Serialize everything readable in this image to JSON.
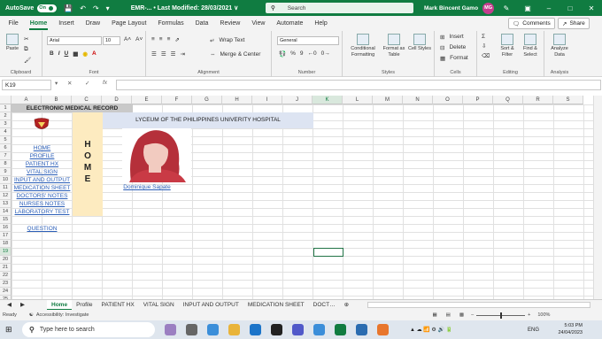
{
  "titlebar": {
    "autosave": "AutoSave",
    "toggle": "On",
    "title": "EMR-... • Last Modified: 28/03/2021 ∨",
    "search_placeholder": "Search",
    "user": "Mark Bincent Gamo",
    "initials": "MG"
  },
  "menu": {
    "tabs": [
      "File",
      "Home",
      "Insert",
      "Draw",
      "Page Layout",
      "Formulas",
      "Data",
      "Review",
      "View",
      "Automate",
      "Help"
    ],
    "comments": "Comments",
    "share": "Share"
  },
  "ribbon": {
    "clipboard": "Clipboard",
    "paste": "Paste",
    "font_name": "Arial",
    "font_size": "10",
    "font_label": "Font",
    "alignment": "Alignment",
    "wrap_text": "Wrap Text",
    "merge_center": "Merge & Center",
    "number_format": "General",
    "number": "Number",
    "conditional": "Conditional Formatting",
    "format_table": "Format as Table",
    "cell_styles": "Cell Styles",
    "styles": "Styles",
    "insert": "Insert",
    "delete": "Delete",
    "format": "Format",
    "cells": "Cells",
    "sort": "Sort & Filter",
    "find": "Find & Select",
    "editing": "Editing",
    "analyze": "Analyze Data",
    "analysis": "Analysis"
  },
  "formula": {
    "namebox": "K19",
    "fx": "fx"
  },
  "columns": [
    "A",
    "B",
    "C",
    "D",
    "E",
    "F",
    "G",
    "H",
    "I",
    "J",
    "K",
    "L",
    "M",
    "N",
    "O",
    "P",
    "Q",
    "R",
    "S"
  ],
  "rows": [
    "1",
    "2",
    "3",
    "4",
    "5",
    "6",
    "7",
    "8",
    "9",
    "10",
    "11",
    "12",
    "13",
    "14",
    "15",
    "16",
    "17",
    "18",
    "19",
    "20",
    "21",
    "22",
    "23",
    "24",
    "25"
  ],
  "sheet": {
    "header": "ELECTRONIC MEDICAL RECORD",
    "hospital": "LYCEUM OF THE PHILIPPINES UNIVERITY HOSPITAL",
    "home_letters": [
      "H",
      "O",
      "M",
      "E"
    ],
    "links": [
      "HOME",
      "PROFILE",
      "PATIENT HX",
      "VITAL SIGN",
      "INPUT AND OUTPUT",
      "MEDICATION SHEET",
      "DOCTORS' NOTES",
      "NURSES NOTES",
      "LABORATORY TEST"
    ],
    "question": "QUESTION",
    "portrait_name": "Dominique Sapate"
  },
  "sheettabs": [
    "Home",
    "Profile",
    "PATIENT HX",
    "VITAL SIGN",
    "INPUT AND OUTPUT",
    "MEDICATION SHEET",
    "DOCT…"
  ],
  "status": {
    "ready": "Ready",
    "accessibility": "Accessibility: Investigate",
    "zoom": "100%"
  },
  "taskbar": {
    "search": "Type here to search",
    "lang": "ENG",
    "time": "5:03 PM",
    "date": "24/04/2023"
  }
}
